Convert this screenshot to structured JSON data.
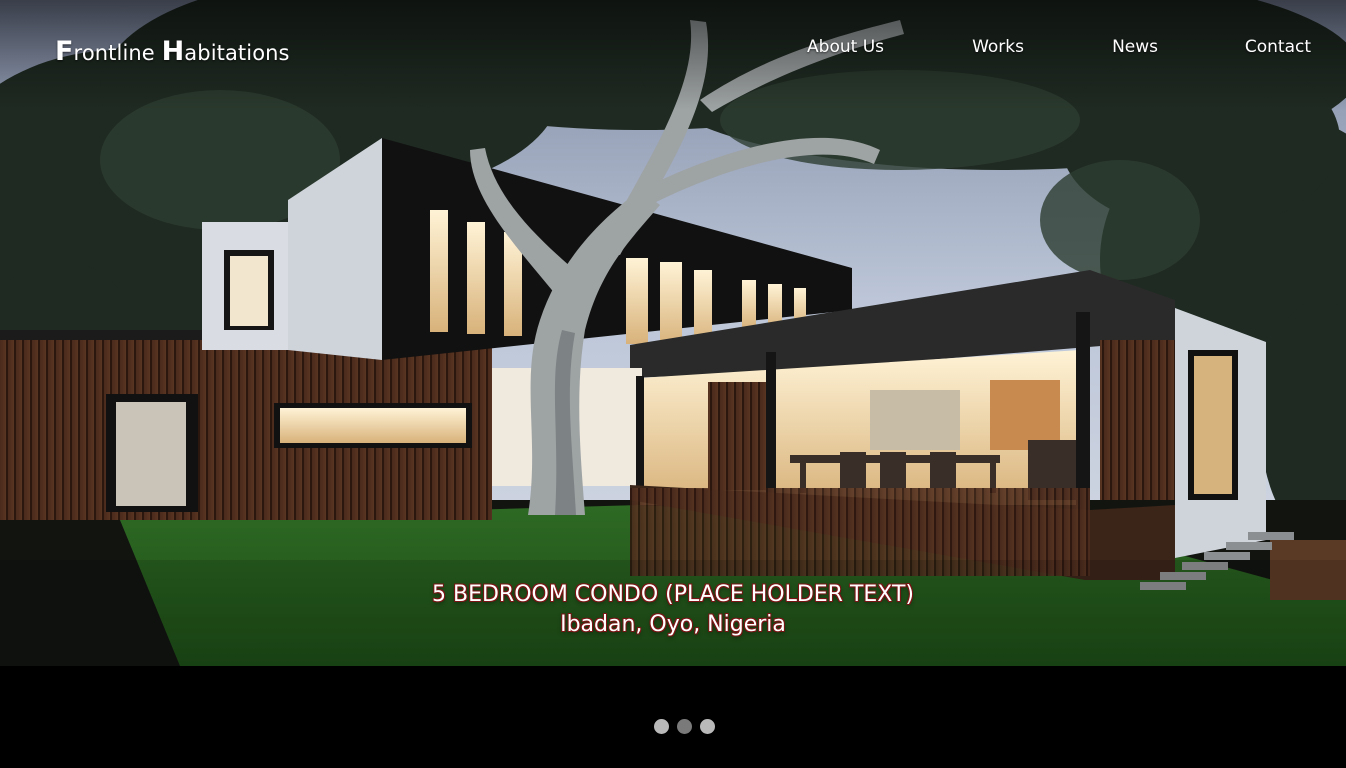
{
  "brand": {
    "first_cap": "F",
    "first_rest": "rontline ",
    "second_cap": "H",
    "second_rest": "abitations"
  },
  "nav": {
    "items": [
      "About Us",
      "Works",
      "News",
      "Contact"
    ]
  },
  "hero": {
    "title": "5 BEDROOM CONDO (PLACE HOLDER TEXT)",
    "location": "Ibadan, Oyo, Nigeria",
    "image": "modern-house-photo"
  },
  "carousel": {
    "slides": 3,
    "active_index": 1
  },
  "colors": {
    "caption_outline": "#7a1414",
    "dot": "#b9b9b9",
    "dot_active": "#7a7a7a"
  }
}
